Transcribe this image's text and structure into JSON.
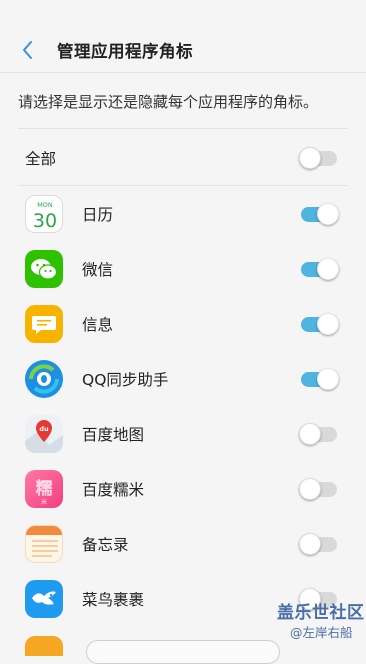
{
  "header": {
    "title": "管理应用程序角标"
  },
  "description": "请选择是显示还是隐藏每个应用程序的角标。",
  "all_row": {
    "label": "全部",
    "enabled": false
  },
  "apps": [
    {
      "label": "日历",
      "icon": "calendar-icon",
      "icon_month": "MON",
      "icon_day": "30",
      "enabled": true
    },
    {
      "label": "微信",
      "icon": "wechat-icon",
      "enabled": true
    },
    {
      "label": "信息",
      "icon": "messages-icon",
      "enabled": true
    },
    {
      "label": "QQ同步助手",
      "icon": "qq-sync-icon",
      "enabled": true
    },
    {
      "label": "百度地图",
      "icon": "baidu-map-icon",
      "icon_text": "du",
      "enabled": false
    },
    {
      "label": "百度糯米",
      "icon": "baidu-nuomi-icon",
      "icon_text": "糯",
      "icon_subtext": "米",
      "enabled": false
    },
    {
      "label": "备忘录",
      "icon": "memo-icon",
      "enabled": false
    },
    {
      "label": "菜鸟裹裹",
      "icon": "cainiao-icon",
      "enabled": false
    }
  ],
  "watermark": {
    "line1": "盖乐世社区",
    "line2": "@左岸右船"
  },
  "colors": {
    "toggle_on": "#4fb4df",
    "toggle_off": "#d9d9d9",
    "back_arrow": "#3a8fd6"
  }
}
